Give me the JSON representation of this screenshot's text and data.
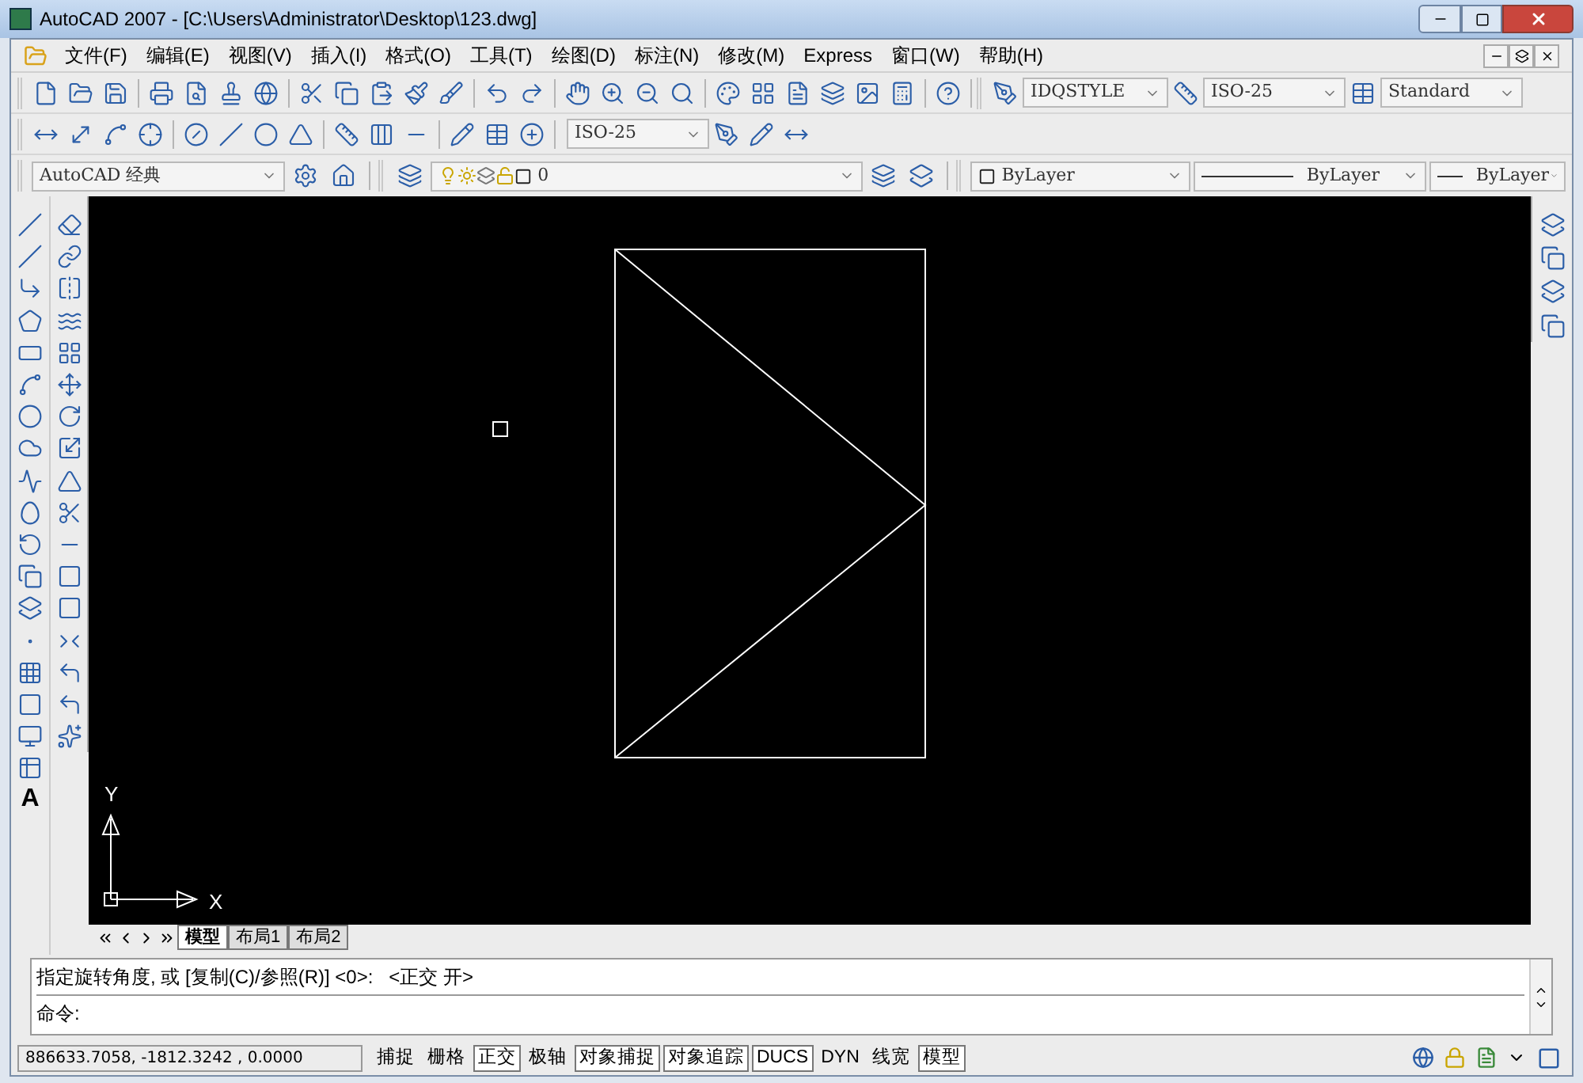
{
  "window": {
    "title": "AutoCAD 2007 - [C:\\Users\\Administrator\\Desktop\\123.dwg]"
  },
  "menu": [
    "文件(F)",
    "编辑(E)",
    "视图(V)",
    "插入(I)",
    "格式(O)",
    "工具(T)",
    "绘图(D)",
    "标注(N)",
    "修改(M)",
    "Express",
    "窗口(W)",
    "帮助(H)"
  ],
  "toolbars": {
    "text_style": "IDQSTYLE",
    "dim_style": "ISO-25",
    "table_style": "Standard",
    "dim_style_2": "ISO-25",
    "workspace": "AutoCAD 经典",
    "layer": "0",
    "object_color": "ByLayer",
    "linetype": "ByLayer",
    "lineweight": "ByLayer"
  },
  "draw_toolbar": {
    "text_tool": "A"
  },
  "canvas": {
    "axis_x": "X",
    "axis_y": "Y"
  },
  "layout_tabs": [
    {
      "label": "模型",
      "selected": true
    },
    {
      "label": "布局1",
      "selected": false
    },
    {
      "label": "布局2",
      "selected": false
    }
  ],
  "command": {
    "history": "指定旋转角度, 或 [复制(C)/参照(R)] <0>:   <正交 开>",
    "prompt": "命令:"
  },
  "status_bar": {
    "coordinates": "886633.7058, -1812.3242 , 0.0000",
    "toggles": [
      {
        "label": "捕捉",
        "on": false
      },
      {
        "label": "栅格",
        "on": false
      },
      {
        "label": "正交",
        "on": true
      },
      {
        "label": "极轴",
        "on": false
      },
      {
        "label": "对象捕捉",
        "on": true
      },
      {
        "label": "对象追踪",
        "on": true
      },
      {
        "label": "DUCS",
        "on": true
      },
      {
        "label": "DYN",
        "on": false
      },
      {
        "label": "线宽",
        "on": false
      },
      {
        "label": "模型",
        "on": true
      }
    ]
  }
}
